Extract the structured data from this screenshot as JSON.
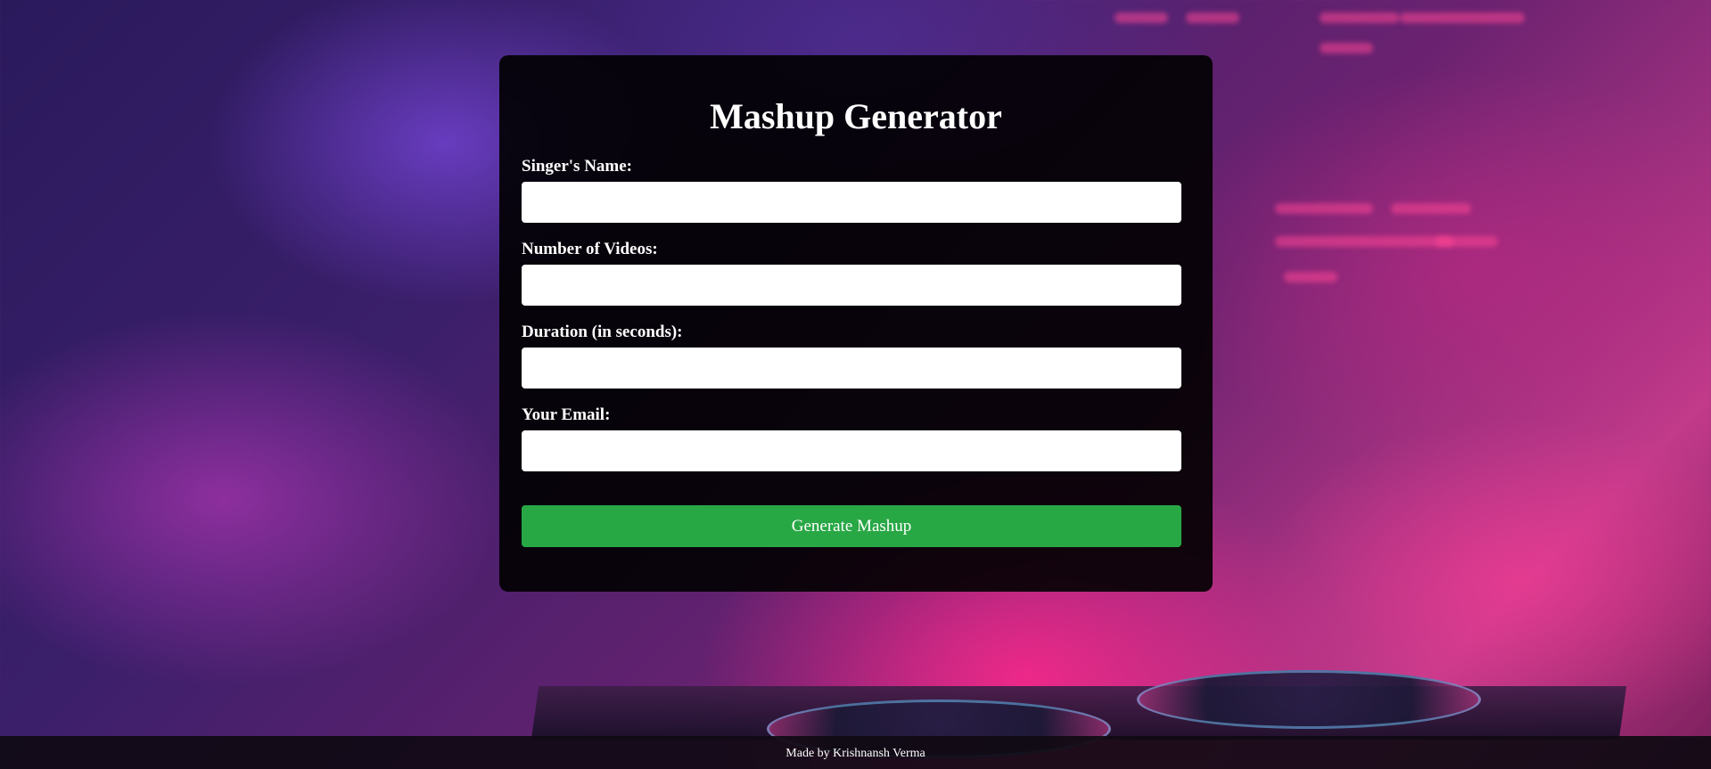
{
  "form": {
    "title": "Mashup Generator",
    "fields": [
      {
        "label": "Singer's Name:",
        "value": ""
      },
      {
        "label": "Number of Videos:",
        "value": ""
      },
      {
        "label": "Duration (in seconds):",
        "value": ""
      },
      {
        "label": "Your Email:",
        "value": ""
      }
    ],
    "submit_label": "Generate Mashup"
  },
  "footer": {
    "text": "Made by Krishnansh Verma"
  },
  "colors": {
    "submit_button": "#28a745",
    "card_background": "#000000",
    "background_accent": "#ff2a8c"
  }
}
